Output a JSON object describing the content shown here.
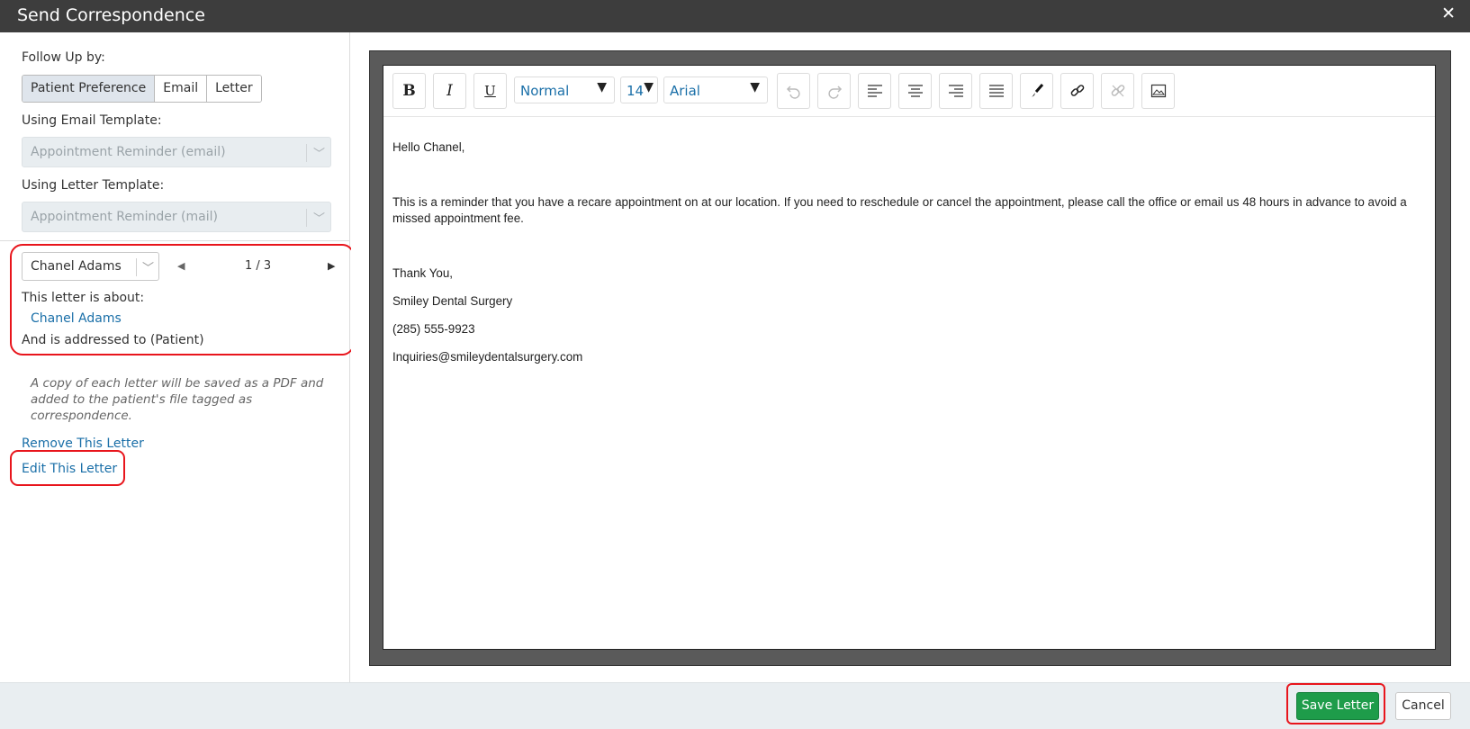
{
  "window": {
    "title": "Send Correspondence",
    "close_glyph": "✕"
  },
  "left_panel": {
    "follow_up_label": "Follow Up by:",
    "follow_up_options": [
      "Patient Preference",
      "Email",
      "Letter"
    ],
    "selected_follow_up": "Patient Preference",
    "email_template_label": "Using Email Template:",
    "email_template_value": "Appointment Reminder (email)",
    "letter_template_label": "Using Letter Template:",
    "letter_template_value": "Appointment Reminder (mail)",
    "patient_select_value": "Chanel Adams",
    "pager_text": "1 / 3",
    "about_label": "This letter is about:",
    "about_name": "Chanel Adams",
    "addressed_to": "And is addressed to (Patient)",
    "note": "A copy of each letter will be saved as a PDF and added to the patient's file tagged as correspondence.",
    "remove_link": "Remove This Letter",
    "edit_link": "Edit This Letter"
  },
  "editor": {
    "toolbar": {
      "bold_icon": "B",
      "italic_icon": "I",
      "underline_icon": "U",
      "paragraph_style": "Normal",
      "font_size": "14",
      "font_family": "Arial"
    },
    "letter_lines": [
      "Hello Chanel,",
      "This is a reminder that you have a recare appointment on  at our  location. If you need to reschedule or cancel the appointment, please call the office or email us 48 hours in advance to avoid a missed appointment fee.",
      "Thank You,",
      "Smiley Dental Surgery",
      "(285) 555-9923",
      "Inquiries@smileydentalsurgery.com"
    ]
  },
  "footer": {
    "save_label": "Save Letter",
    "cancel_label": "Cancel"
  },
  "colors": {
    "title_bar": "#3d3d3d",
    "save_button": "#1e9c4a",
    "link": "#1a6fa8",
    "highlight_box": "#e8151c"
  }
}
